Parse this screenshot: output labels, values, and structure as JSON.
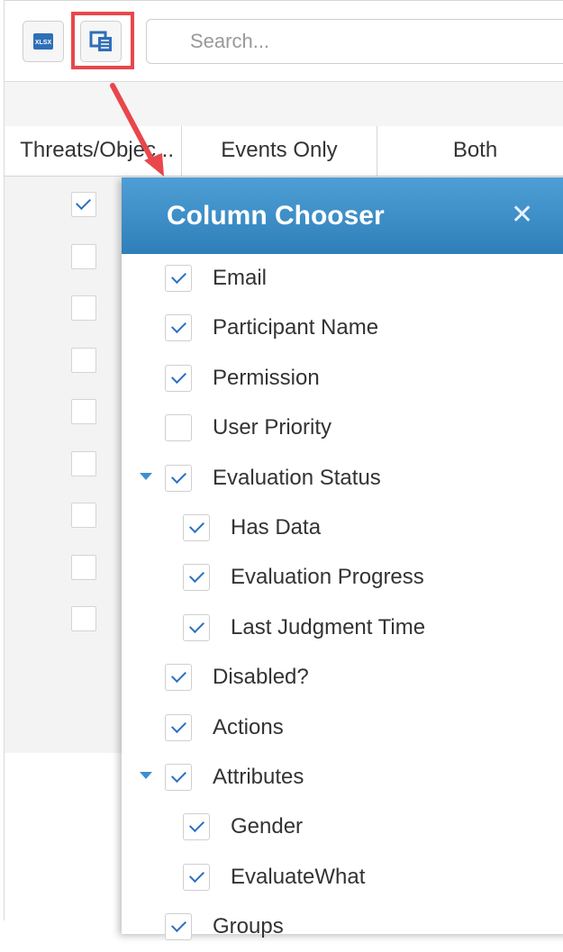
{
  "toolbar": {
    "export_icon": "xlsx-export-icon",
    "export_icon_text": "XLSX",
    "column_chooser_icon": "column-chooser-icon",
    "search_placeholder": "Search..."
  },
  "grid": {
    "columns": [
      "Threats/Objec...",
      "Events Only",
      "Both"
    ],
    "row_checks": [
      true,
      false,
      false,
      false,
      false,
      false,
      false,
      false,
      false
    ]
  },
  "column_chooser": {
    "title": "Column Chooser",
    "close_icon": "close-icon",
    "items": [
      {
        "label": "Email",
        "checked": true,
        "level": 0,
        "expandable": false
      },
      {
        "label": "Participant Name",
        "checked": true,
        "level": 0,
        "expandable": false
      },
      {
        "label": "Permission",
        "checked": true,
        "level": 0,
        "expandable": false
      },
      {
        "label": "User Priority",
        "checked": false,
        "level": 0,
        "expandable": false
      },
      {
        "label": "Evaluation Status",
        "checked": true,
        "level": 0,
        "expandable": true
      },
      {
        "label": "Has Data",
        "checked": true,
        "level": 1,
        "expandable": false
      },
      {
        "label": "Evaluation Progress",
        "checked": true,
        "level": 1,
        "expandable": false
      },
      {
        "label": "Last Judgment Time",
        "checked": true,
        "level": 1,
        "expandable": false
      },
      {
        "label": "Disabled?",
        "checked": true,
        "level": 0,
        "expandable": false
      },
      {
        "label": "Actions",
        "checked": true,
        "level": 0,
        "expandable": false
      },
      {
        "label": "Attributes",
        "checked": true,
        "level": 0,
        "expandable": true
      },
      {
        "label": "Gender",
        "checked": true,
        "level": 1,
        "expandable": false
      },
      {
        "label": "EvaluateWhat",
        "checked": true,
        "level": 1,
        "expandable": false
      },
      {
        "label": "Groups",
        "checked": true,
        "level": 0,
        "expandable": false
      }
    ]
  },
  "colors": {
    "header_blue": "#2e7fb9",
    "check_blue": "#2a6fc1",
    "highlight_red": "#e8474c"
  }
}
